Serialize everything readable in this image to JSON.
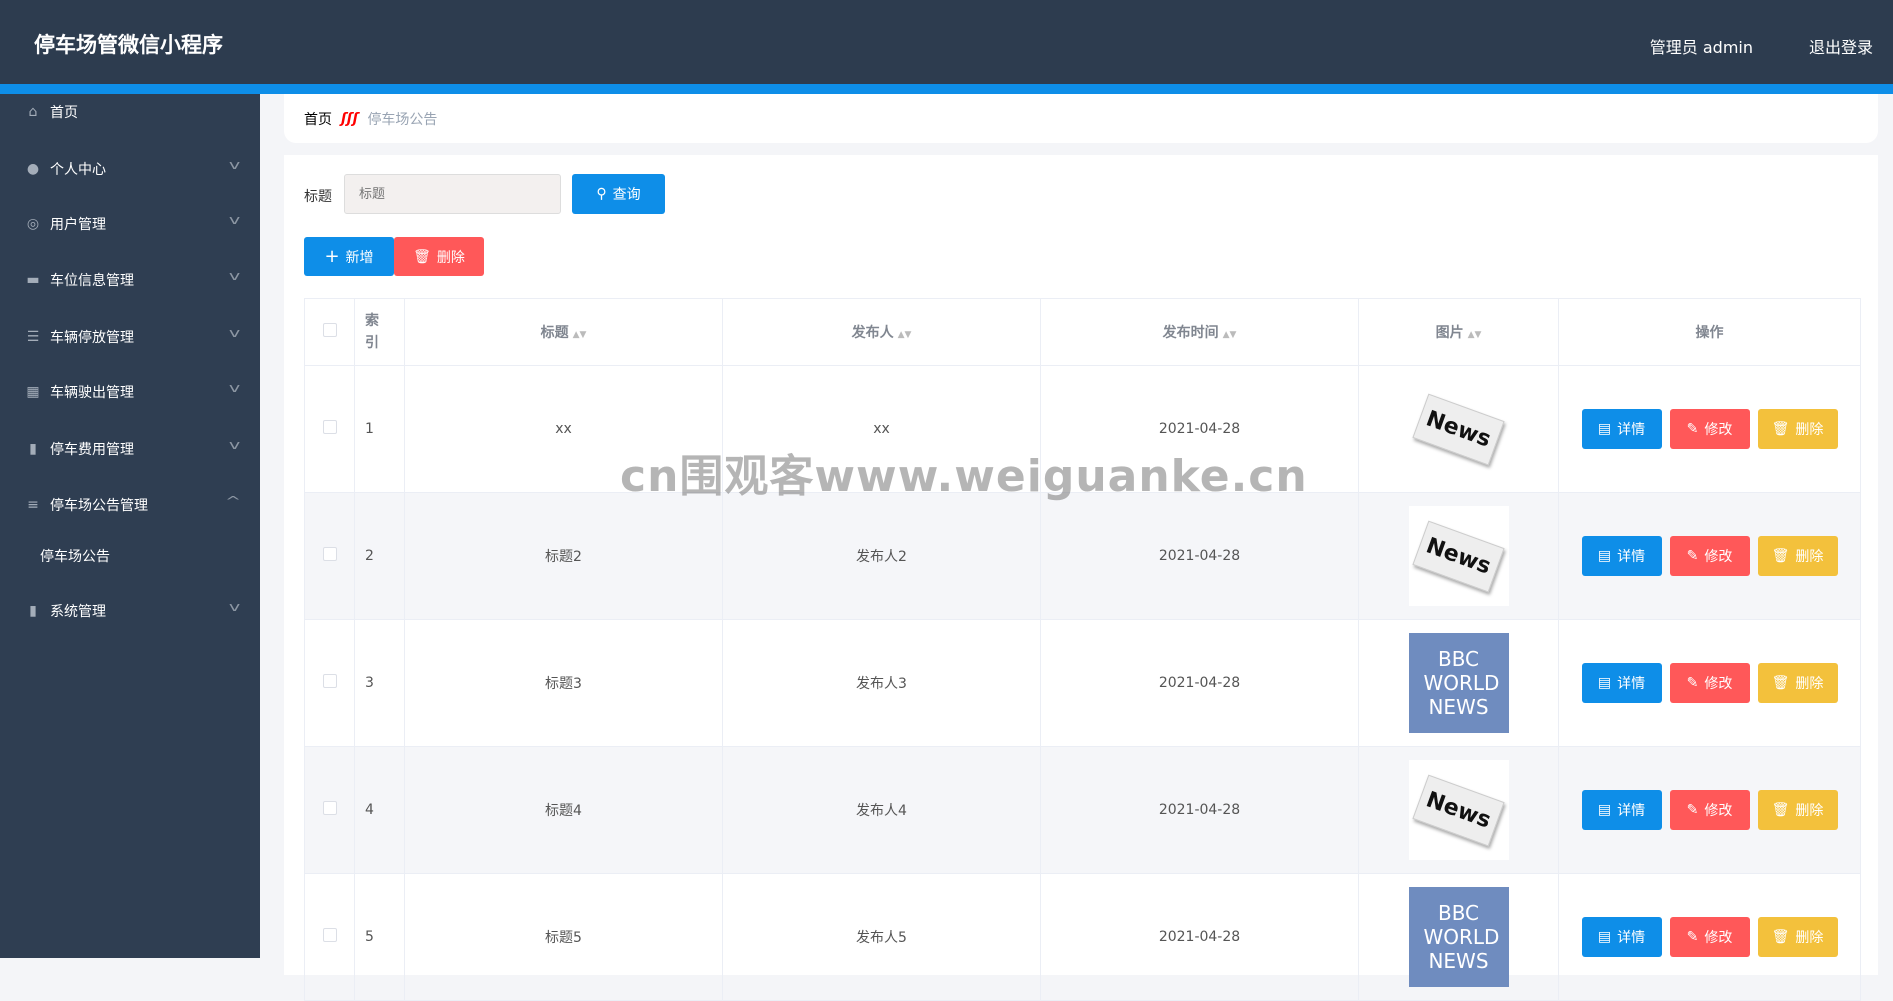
{
  "header": {
    "title": "停车场管微信小程序",
    "user": "管理员 admin",
    "logout": "退出登录"
  },
  "sidebar": {
    "items": [
      {
        "label": "首页",
        "icon": "home-icon",
        "chev": false
      },
      {
        "label": "个人中心",
        "icon": "user-icon",
        "chev": true
      },
      {
        "label": "用户管理",
        "icon": "lifebuoy-icon",
        "chev": true
      },
      {
        "label": "车位信息管理",
        "icon": "monitor-icon",
        "chev": true
      },
      {
        "label": "车辆停放管理",
        "icon": "list-icon",
        "chev": true
      },
      {
        "label": "车辆驶出管理",
        "icon": "grid-icon",
        "chev": true
      },
      {
        "label": "停车费用管理",
        "icon": "bars-icon",
        "chev": true
      },
      {
        "label": "停车场公告管理",
        "icon": "sliders-icon",
        "chev": true
      }
    ],
    "sub": "停车场公告",
    "last": "系统管理"
  },
  "breadcrumb": {
    "home": "首页",
    "sep": "ʃʃʃ",
    "current": "停车场公告"
  },
  "search": {
    "label": "标题",
    "placeholder": "标题",
    "button": "查询"
  },
  "toolbar": {
    "add": "新增",
    "delete": "删除"
  },
  "table": {
    "headers": [
      "索引",
      "标题",
      "发布人",
      "发布时间",
      "图片",
      "操作"
    ],
    "rows": [
      {
        "idx": "1",
        "title": "xx",
        "author": "xx",
        "date": "2021-04-28",
        "image": "News"
      },
      {
        "idx": "2",
        "title": "标题2",
        "author": "发布人2",
        "date": "2021-04-28",
        "image": "News"
      },
      {
        "idx": "3",
        "title": "标题3",
        "author": "发布人3",
        "date": "2021-04-28",
        "image": "BBC WORLD NEWS"
      },
      {
        "idx": "4",
        "title": "标题4",
        "author": "发布人4",
        "date": "2021-04-28",
        "image": "News"
      },
      {
        "idx": "5",
        "title": "标题5",
        "author": "发布人5",
        "date": "2021-04-28",
        "image": "BBC WORLD NEWS"
      }
    ],
    "actions": {
      "detail": "详情",
      "edit": "修改",
      "delete": "删除"
    }
  },
  "watermark": "cn围观客www.weiguanke.cn"
}
